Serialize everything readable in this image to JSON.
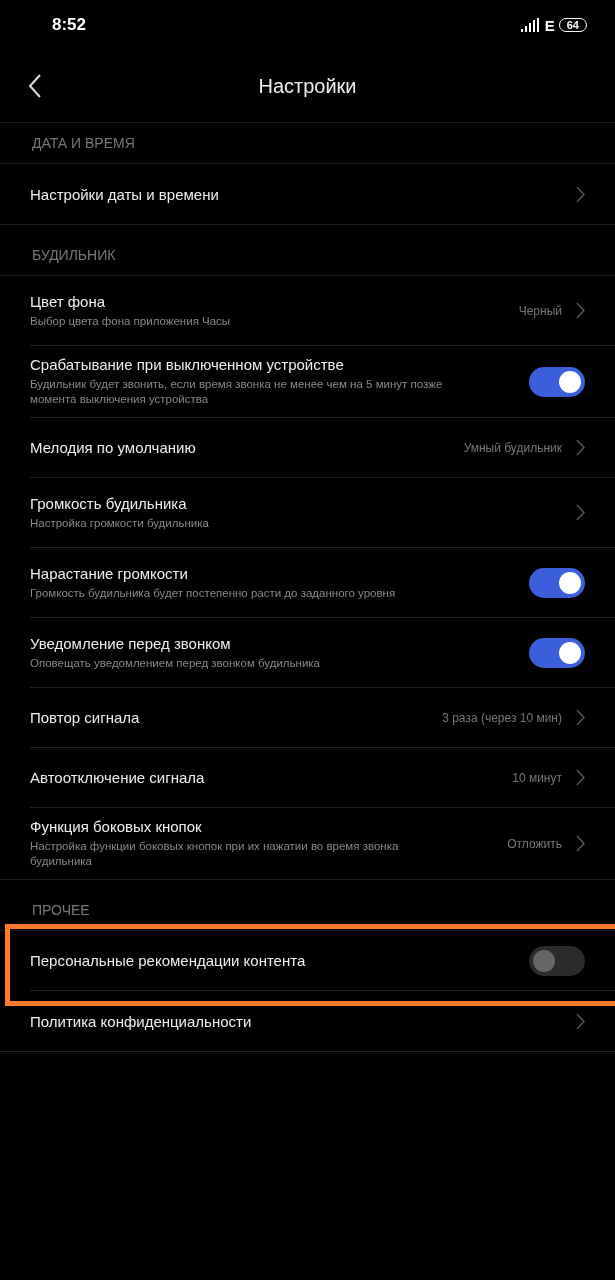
{
  "status_bar": {
    "time": "8:52",
    "network": "E",
    "battery": "64"
  },
  "header": {
    "title": "Настройки"
  },
  "sections": [
    {
      "title": "ДАТА И ВРЕМЯ",
      "items": [
        {
          "kind": "link",
          "title": "Настройки даты и времени"
        }
      ]
    },
    {
      "title": "БУДИЛЬНИК",
      "items": [
        {
          "kind": "link",
          "title": "Цвет фона",
          "subtitle": "Выбор цвета фона приложения Часы",
          "value": "Черный"
        },
        {
          "kind": "toggle",
          "title": "Срабатывание при выключенном устройстве",
          "subtitle": "Будильник будет звонить, если время звонка не менее чем на 5 минут позже момента выключения устройства",
          "on": true
        },
        {
          "kind": "link",
          "title": "Мелодия по умолчанию",
          "value": "Умный будильник"
        },
        {
          "kind": "link",
          "title": "Громкость будильника",
          "subtitle": "Настройка громкости будильника"
        },
        {
          "kind": "toggle",
          "title": "Нарастание громкости",
          "subtitle": "Громкость будильника будет постепенно расти до заданного уровня",
          "on": true
        },
        {
          "kind": "toggle",
          "title": "Уведомление перед звонком",
          "subtitle": "Оповещать уведомлением перед звонком будильника",
          "on": true
        },
        {
          "kind": "link",
          "title": "Повтор сигнала",
          "value": "3 раза (через 10 мин)"
        },
        {
          "kind": "link",
          "title": "Автоотключение сигнала",
          "value": "10 минут"
        },
        {
          "kind": "link",
          "title": "Функция боковых кнопок",
          "subtitle": "Настройка функции боковых кнопок при их нажатии во время звонка будильника",
          "value": "Отложить"
        }
      ]
    },
    {
      "title": "ПРОЧЕЕ",
      "items": [
        {
          "kind": "toggle",
          "title": "Персональные рекомендации контента",
          "on": false,
          "highlighted": true
        },
        {
          "kind": "link",
          "title": "Политика конфиденциальности"
        }
      ]
    }
  ]
}
